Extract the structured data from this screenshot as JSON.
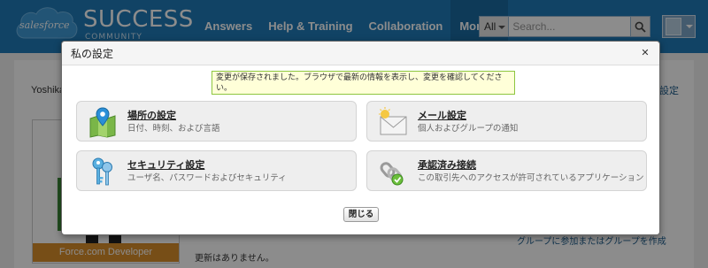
{
  "header": {
    "logo": {
      "brand": "salesforce",
      "product": "SUCCESS",
      "sub": "COMMUNITY"
    },
    "nav": [
      "Answers",
      "Help & Training",
      "Collaboration",
      "More"
    ],
    "search": {
      "scope": "All",
      "placeholder": "Search..."
    },
    "accent": "#1f7ab8"
  },
  "page": {
    "user_name": "Yoshika",
    "right_link": "設定",
    "profile_banner": "Force.com Developer",
    "no_updates": "更新はありません。",
    "join_group": "グループに参加またはグループを作成"
  },
  "modal": {
    "title": "私の設定",
    "message": "変更が保存されました。ブラウザで最新の情報を表示し、変更を確認してください。",
    "tiles": [
      {
        "icon": "location-map-icon",
        "title": "場所の設定",
        "desc": "日付、時刻、および言語"
      },
      {
        "icon": "email-icon",
        "title": "メール設定",
        "desc": "個人およびグループの通知"
      },
      {
        "icon": "keys-icon",
        "title": "セキュリティ設定",
        "desc": "ユーザ名、パスワードおよびセキュリティ"
      },
      {
        "icon": "connected-apps-icon",
        "title": "承認済み接続",
        "desc": "この取引先へのアクセスが許可されているアプリケーション"
      }
    ],
    "close_label": "閉じる"
  }
}
